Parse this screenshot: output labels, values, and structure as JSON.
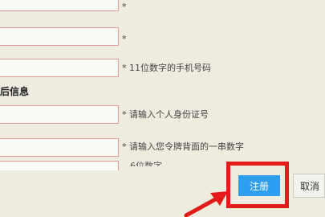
{
  "form": {
    "fields": [
      {
        "required_mark": "*",
        "hint": ""
      },
      {
        "required_mark": "*",
        "hint": ""
      },
      {
        "required_mark": "*",
        "hint": "11位数字的手机号码"
      },
      {
        "required_mark": "*",
        "hint": "请输入个人身份证号"
      },
      {
        "required_mark": "*",
        "hint": "请输入您令牌背面的一串数字"
      }
    ],
    "section_title": "后信息",
    "partial_hint": "6位数字"
  },
  "actions": {
    "register_label": "注册",
    "cancel_label": "取消"
  },
  "annotation": {
    "highlight_color": "#e21b1b"
  }
}
